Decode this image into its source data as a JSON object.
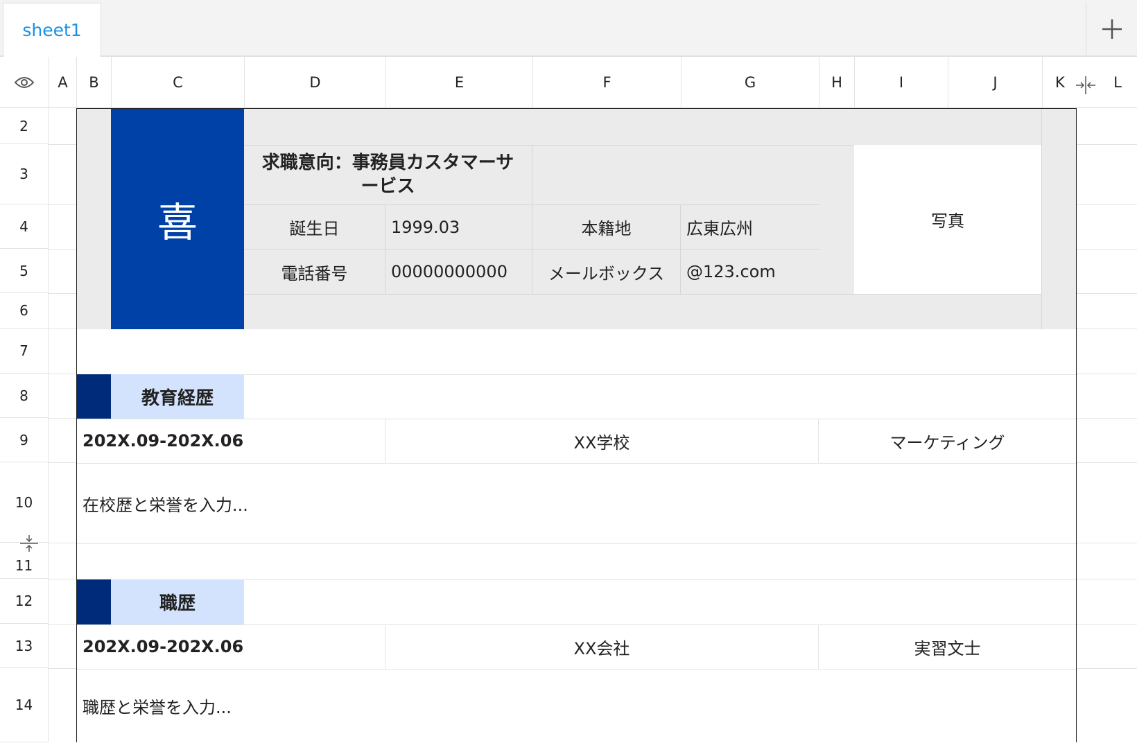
{
  "tabs": {
    "sheet1": "sheet1"
  },
  "columns": [
    "A",
    "B",
    "C",
    "D",
    "E",
    "F",
    "G",
    "H",
    "I",
    "J",
    "K",
    "L"
  ],
  "rows": [
    "2",
    "3",
    "4",
    "5",
    "6",
    "7",
    "8",
    "9",
    "10",
    "11",
    "12",
    "13",
    "14"
  ],
  "resume": {
    "name_char": "喜",
    "job_intent": "求職意向：事務員カスタマーサービス",
    "birthday_label": "誕生日",
    "birthday_value": "1999.03",
    "hometown_label": "本籍地",
    "hometown_value": "広東広州",
    "phone_label": "電話番号",
    "phone_value": "00000000000",
    "email_label": "メールボックス",
    "email_value": "@123.com",
    "photo_label": "写真"
  },
  "education": {
    "title": "教育経歴",
    "period": "202X.09-202X.06",
    "school": "XX学校",
    "major": "マーケティング",
    "description": "在校歴と栄誉を入力..."
  },
  "work": {
    "title": "職歴",
    "period": "202X.09-202X.06",
    "company": "XX会社",
    "position": "実習文士",
    "description": "職歴と栄誉を入力..."
  },
  "colors": {
    "brand_blue": "#0041a8",
    "dark_navy": "#002a7a",
    "light_blue": "#d3e2fd",
    "tab_blue": "#1a8fe3"
  },
  "icons": {
    "eye": "eye-icon",
    "add": "plus-icon",
    "col_resize": "column-collapse-icon",
    "row_resize": "row-collapse-icon"
  }
}
